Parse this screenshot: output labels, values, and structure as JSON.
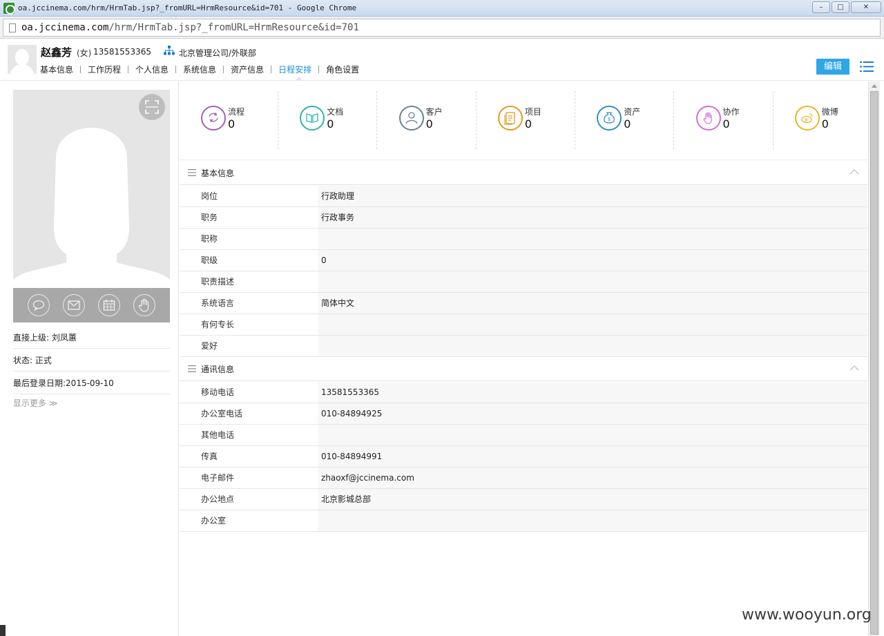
{
  "window": {
    "title": "oa.jccinema.com/hrm/HrmTab.jsp?_fromURL=HrmResource&id=701 - Google Chrome",
    "controls": {
      "minimize": "–",
      "maximize": "□",
      "close": "✕"
    }
  },
  "address": {
    "host": "oa.jccinema.com",
    "path": "/hrm/HrmTab.jsp?_fromURL=HrmResource&id=701"
  },
  "header": {
    "name": "赵鑫芳",
    "gender": "(女)",
    "phone": "13581553365",
    "org": "北京管理公司/外联部",
    "tabs": [
      {
        "label": "基本信息",
        "active": false
      },
      {
        "label": "工作历程",
        "active": false
      },
      {
        "label": "个人信息",
        "active": false
      },
      {
        "label": "系统信息",
        "active": false
      },
      {
        "label": "资产信息",
        "active": false
      },
      {
        "label": "日程安排",
        "active": true
      },
      {
        "label": "角色设置",
        "active": false
      }
    ],
    "edit_label": "编辑"
  },
  "left": {
    "supervisor": "直接上级: 刘凤蕙",
    "status": "状态: 正式",
    "last_login": "最后登录日期:2015-09-10",
    "show_more": "显示更多 ≫"
  },
  "stats": [
    {
      "label": "流程",
      "value": "0",
      "color": "#a05fc0",
      "icon": "workflow-icon"
    },
    {
      "label": "文档",
      "value": "0",
      "color": "#30b3a8",
      "icon": "document-icon"
    },
    {
      "label": "客户",
      "value": "0",
      "color": "#6b7f98",
      "icon": "customer-icon"
    },
    {
      "label": "项目",
      "value": "0",
      "color": "#e69a1f",
      "icon": "project-icon"
    },
    {
      "label": "资产",
      "value": "0",
      "color": "#2f8fc0",
      "icon": "asset-icon"
    },
    {
      "label": "协作",
      "value": "0",
      "color": "#d36fd6",
      "icon": "cooperation-icon"
    },
    {
      "label": "微博",
      "value": "0",
      "color": "#e6b820",
      "icon": "weibo-icon"
    }
  ],
  "basic": {
    "title": "基本信息",
    "rows": [
      {
        "k": "岗位",
        "v": "行政助理"
      },
      {
        "k": "职务",
        "v": "行政事务"
      },
      {
        "k": "职称",
        "v": ""
      },
      {
        "k": "职级",
        "v": "0"
      },
      {
        "k": "职责描述",
        "v": ""
      },
      {
        "k": "系统语言",
        "v": "简体中文"
      },
      {
        "k": "有何专长",
        "v": ""
      },
      {
        "k": "爱好",
        "v": ""
      }
    ]
  },
  "contact": {
    "title": "通讯信息",
    "rows": [
      {
        "k": "移动电话",
        "v": "13581553365"
      },
      {
        "k": "办公室电话",
        "v": "010-84894925"
      },
      {
        "k": "其他电话",
        "v": ""
      },
      {
        "k": "传真",
        "v": "010-84894991"
      },
      {
        "k": "电子邮件",
        "v": "zhaoxf@jccinema.com"
      },
      {
        "k": "办公地点",
        "v": "北京影城总部"
      },
      {
        "k": "办公室",
        "v": ""
      }
    ]
  },
  "watermark": "www.wooyun.org"
}
